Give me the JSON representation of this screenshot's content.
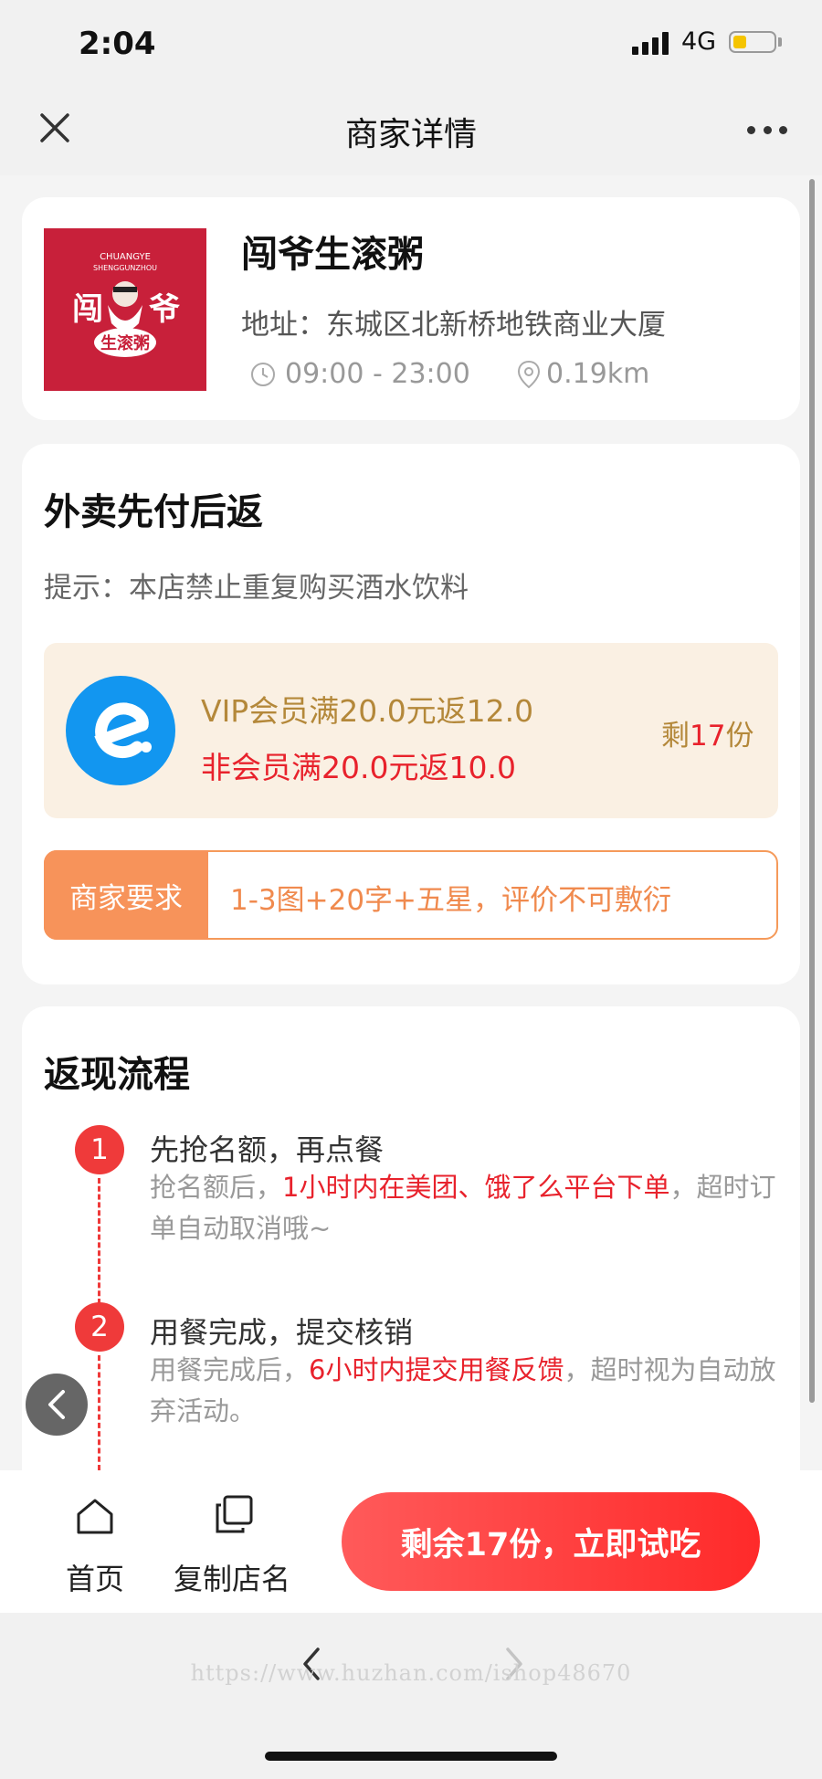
{
  "status_bar": {
    "time": "2:04",
    "network": "4G",
    "battery_level": 0.25
  },
  "nav": {
    "title": "商家详情",
    "close_icon": "close-icon",
    "more_icon": "more-icon"
  },
  "shop": {
    "name": "闯爷生滚粥",
    "logo_text": "CHUANGYE SHENGGUNZHOU",
    "address": "地址：东城区北新桥地铁商业大厦",
    "hours": "09:00 - 23:00",
    "distance": "0.19km"
  },
  "promo": {
    "title": "外卖先付后返",
    "tip": "提示：本店禁止重复购买酒水饮料",
    "vip_offer": "VIP会员满20.0元返12.0",
    "non_vip_offer": "非会员满20.0元返10.0",
    "remain_prefix": "剩",
    "remain_count": "17",
    "remain_suffix": "份",
    "req_label": "商家要求",
    "req_text": "1-3图+20字+五星，评价不可敷衍"
  },
  "flow": {
    "title": "返现流程",
    "steps": [
      {
        "num": "1",
        "title": "先抢名额，再点餐",
        "desc_a": "抢名额后，",
        "desc_hl": "1小时内在美团、饿了么平台下单",
        "desc_b": "，超时订单自动取消哦~"
      },
      {
        "num": "2",
        "title": "用餐完成，提交核销",
        "desc_a": "用餐完成后，",
        "desc_hl": "6小时内提交用餐反馈",
        "desc_b": "，超时视为自动放弃活动。"
      }
    ]
  },
  "actions": {
    "home_label": "首页",
    "copy_label": "复制店名",
    "cta_label": "剩余17份，立即试吃"
  },
  "browser": {
    "watermark": "https://www.huzhan.com/ishop48670"
  },
  "colors": {
    "accent_red": "#e8222c",
    "gold": "#b4883a",
    "orange": "#f7935a"
  }
}
